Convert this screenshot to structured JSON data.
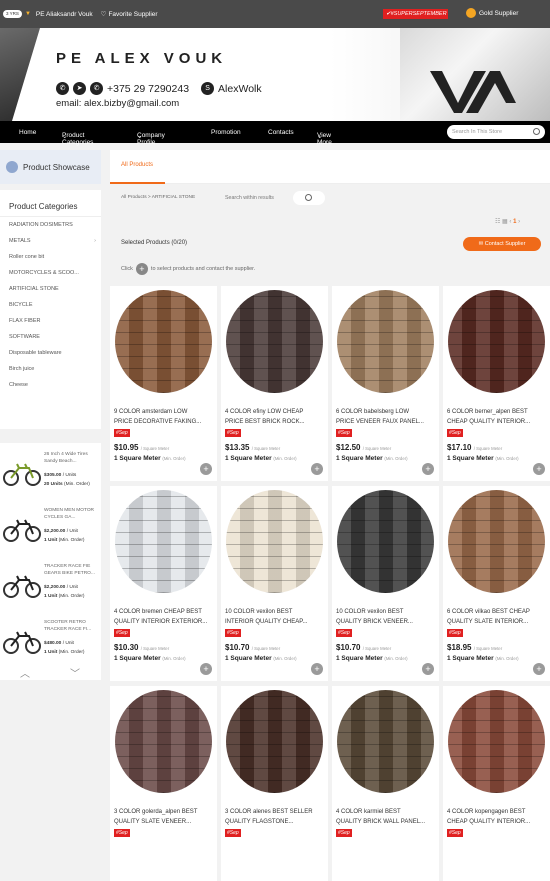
{
  "topbar": {
    "level": "3 YRS",
    "store": "PE Aliaksandr Vouk",
    "favorite": "Favorite Supplier",
    "promo": "#SUPERSEPTEMBER",
    "gold": "Gold Supplier"
  },
  "banner": {
    "name": "PE ALEX VOUK",
    "phone": "+375 29 7290243",
    "skype": "AlexWolk",
    "email": "email: alex.bizby@gmail.com"
  },
  "nav": {
    "home": "Home",
    "categories": "Product Categories",
    "profile": "Company Profile",
    "promotion": "Promotion",
    "contacts": "Contacts",
    "more": "View More",
    "search_placeholder": "Search In This Store"
  },
  "sidebar": {
    "showcase": "Product Showcase",
    "categories_title": "Product Categories",
    "categories": [
      "RADIATION DOSIMETRS",
      "METALS",
      "Roller cone bit",
      "MOTORCYCLES & SCOO...",
      "ARTIFICIAL STONE",
      "BICYCLE",
      "FLAX FIBER",
      "SOFTWARE",
      "Disposable tableware",
      "Birch juice",
      "Cheese"
    ],
    "featured": [
      {
        "title": "26 Inch 4 Wide Tires Sandy Beach...",
        "price": "$305.00",
        "unit": "/ Units",
        "moq": "20 Units",
        "moq_note": "(Min. Order)"
      },
      {
        "title": "WOMEN MEN MOTOR CYCLES GA...",
        "price": "$2,200.00",
        "unit": "/ Unit",
        "moq": "1 Unit",
        "moq_note": "(Min. Order)"
      },
      {
        "title": "TRACKER RACE FIE GEARS BIKE PETRO...",
        "price": "$2,200.00",
        "unit": "/ Unit",
        "moq": "1 Unit",
        "moq_note": "(Min. Order)"
      },
      {
        "title": "SCOOTER RETRO TRACKER RACE FI...",
        "price": "$480.00",
        "unit": "/ Unit",
        "moq": "1 Unit",
        "moq_note": "(Min. Order)"
      }
    ]
  },
  "main": {
    "tab": "All Products",
    "crumb": "All Products  >  ARTIFICIAL STONE",
    "within": "Search within results",
    "pager": "1",
    "selected": "Selected Products (0/20)",
    "contact_btn": "Contact Supplier",
    "click_pre": "Click",
    "click_post": "to select products and contact the supplier.",
    "products": [
      {
        "title": "9 COLOR amsterdam LOW\nPRICE DECORATIVE FAKING...",
        "tag": "#Sep",
        "price": "$10.95",
        "unit": "/ Square Meter",
        "moq": "1 Square Meter",
        "note": "(Min. Order)",
        "color": "#8a5a3a"
      },
      {
        "title": "4 COLOR efiny LOW CHEAP\nPRICE BEST BRICK ROCK...",
        "tag": "#Sep",
        "price": "$13.35",
        "unit": "/ Square Meter",
        "moq": "1 Square Meter",
        "note": "(Min. Order)",
        "color": "#4a3a38"
      },
      {
        "title": "6 COLOR babelsberg LOW\nPRICE VENEER FAUX PANEL...",
        "tag": "#Sep",
        "price": "$12.50",
        "unit": "/ Square Meter",
        "moq": "1 Square Meter",
        "note": "(Min. Order)",
        "color": "#a08060"
      },
      {
        "title": "6 COLOR berner_alpen BEST\nCHEAP QUALITY INTERIOR...",
        "tag": "#Sep",
        "price": "$17.10",
        "unit": "/ Square Meter",
        "moq": "1 Square Meter",
        "note": "(Min. Order)",
        "color": "#5a2a22"
      },
      {
        "title": "4 COLOR bremen CHEAP BEST\nQUALITY INTERIOR EXTERIOR...",
        "tag": "#Sep",
        "price": "$10.30",
        "unit": "/ Square Meter",
        "moq": "1 Square Meter",
        "note": "(Min. Order)",
        "color": "#e2e6ea"
      },
      {
        "title": "10 COLOR vexilon BEST\nINTERIOR QUALITY CHEAP...",
        "tag": "#Sep",
        "price": "$10.70",
        "unit": "/ Square Meter",
        "moq": "1 Square Meter",
        "note": "(Min. Order)",
        "color": "#ece2d2"
      },
      {
        "title": "10 COLOR vexilon BEST\nQUALITY BRICK VENEER...",
        "tag": "#Sep",
        "price": "$10.70",
        "unit": "/ Square Meter",
        "moq": "1 Square Meter",
        "note": "(Min. Order)",
        "color": "#3a3a3a"
      },
      {
        "title": "6 COLOR vilkao BEST CHEAP\nQUALITY SLATE INTERIOR...",
        "tag": "#Sep",
        "price": "$18.95",
        "unit": "/ Square Meter",
        "moq": "1 Square Meter",
        "note": "(Min. Order)",
        "color": "#9a6a4a"
      },
      {
        "title": "3 COLOR golerda_alpen BEST\nQUALITY SLATE VENEER...",
        "tag": "#Sep",
        "price": "",
        "unit": "",
        "moq": "",
        "note": "",
        "color": "#6a4a48"
      },
      {
        "title": "3 COLOR alenes BEST SELLER\nQUALITY FLAGSTONE...",
        "tag": "#Sep",
        "price": "",
        "unit": "",
        "moq": "",
        "note": "",
        "color": "#4a3028"
      },
      {
        "title": "4 COLOR karmiel BEST\nQUALITY BRICK WALL PANEL...",
        "tag": "#Sep",
        "price": "",
        "unit": "",
        "moq": "",
        "note": "",
        "color": "#5a4a38"
      },
      {
        "title": "4 COLOR kopengagen BEST\nCHEAP QUALITY INTERIOR...",
        "tag": "#Sep",
        "price": "",
        "unit": "",
        "moq": "",
        "note": "",
        "color": "#8a4a3a"
      }
    ]
  }
}
